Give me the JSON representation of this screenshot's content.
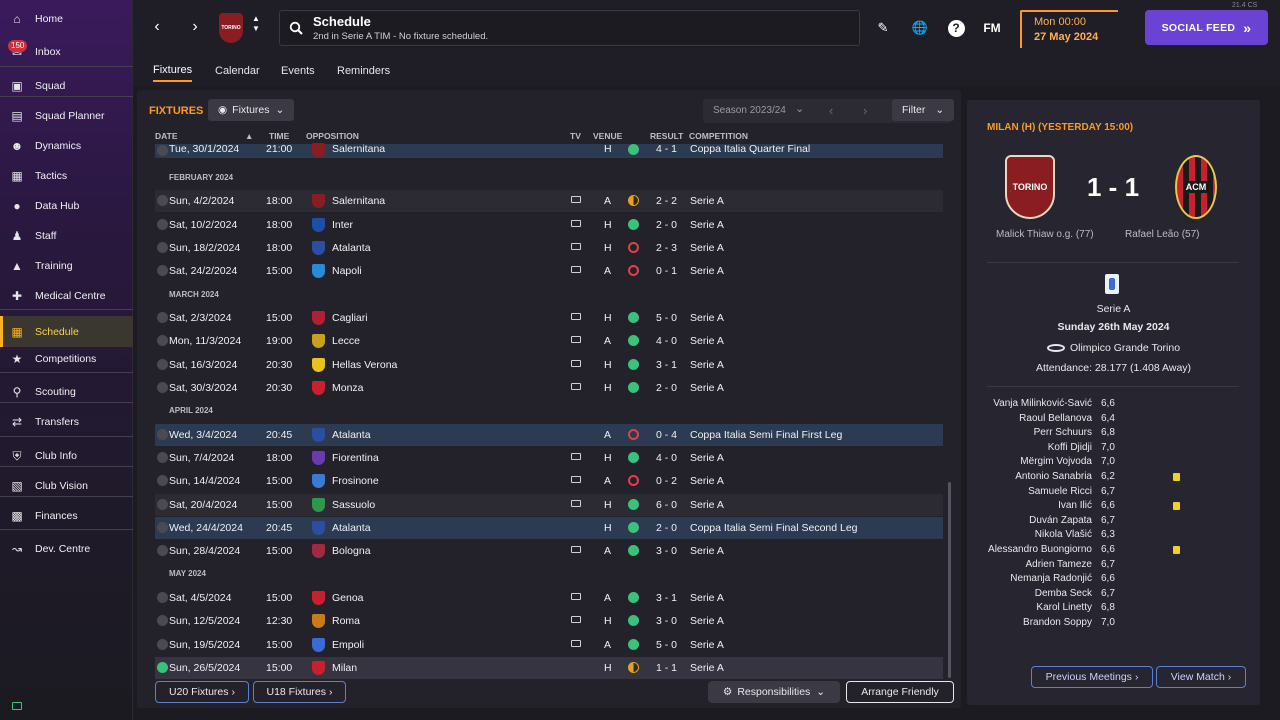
{
  "version_label": "21.4 CS",
  "sidebar": {
    "inbox_badge": "150",
    "items": [
      {
        "label": "Home",
        "icon": "home-icon"
      },
      {
        "label": "Inbox",
        "icon": "mail-icon"
      },
      {
        "label": "Squad",
        "icon": "shirt-icon"
      },
      {
        "label": "Squad Planner",
        "icon": "clipboard-icon"
      },
      {
        "label": "Dynamics",
        "icon": "people-icon"
      },
      {
        "label": "Tactics",
        "icon": "tactics-board-icon"
      },
      {
        "label": "Data Hub",
        "icon": "data-hub-icon"
      },
      {
        "label": "Staff",
        "icon": "staff-icon"
      },
      {
        "label": "Training",
        "icon": "cone-icon"
      },
      {
        "label": "Medical Centre",
        "icon": "medical-icon"
      },
      {
        "label": "Schedule",
        "icon": "calendar-icon"
      },
      {
        "label": "Competitions",
        "icon": "trophy-icon"
      },
      {
        "label": "Scouting",
        "icon": "magnifier-icon"
      },
      {
        "label": "Transfers",
        "icon": "transfer-arrows-icon"
      },
      {
        "label": "Club Info",
        "icon": "shield-icon"
      },
      {
        "label": "Club Vision",
        "icon": "briefcase-icon"
      },
      {
        "label": "Finances",
        "icon": "money-icon"
      },
      {
        "label": "Dev. Centre",
        "icon": "growth-icon"
      }
    ]
  },
  "header": {
    "title": "Schedule",
    "subtitle": "2nd in Serie A TIM - No fixture scheduled.",
    "club_crest_text": "TORINO",
    "fm_label": "FM",
    "date_line1": "Mon 00:00",
    "date_line2": "27 May 2024",
    "social_feed": "SOCIAL FEED"
  },
  "tabs": [
    "Fixtures",
    "Calendar",
    "Events",
    "Reminders"
  ],
  "fixtures": {
    "title": "FIXTURES",
    "view_button": "Fixtures",
    "season": "Season 2023/24",
    "filter": "Filter",
    "columns": {
      "date": "DATE",
      "time": "TIME",
      "opposition": "OPPOSITION",
      "tv": "TV",
      "venue": "VENUE",
      "result": "RESULT",
      "competition": "COMPETITION"
    },
    "months": [
      "FEBRUARY 2024",
      "MARCH 2024",
      "APRIL 2024",
      "MAY 2024"
    ],
    "rows": [
      {
        "date": "Tue, 30/1/2024",
        "time": "21:00",
        "opp": "Salernitana",
        "tv": false,
        "venue": "H",
        "outcome": "win",
        "result": "4 - 1",
        "comp": "Coppa Italia Quarter Final",
        "color": "#8a1d22"
      },
      {
        "date": "Sun, 4/2/2024",
        "time": "18:00",
        "opp": "Salernitana",
        "tv": true,
        "venue": "A",
        "outcome": "draw",
        "result": "2 - 2",
        "comp": "Serie A",
        "color": "#8a1d22"
      },
      {
        "date": "Sat, 10/2/2024",
        "time": "18:00",
        "opp": "Inter",
        "tv": true,
        "venue": "H",
        "outcome": "win",
        "result": "2 - 0",
        "comp": "Serie A",
        "color": "#1e4fa8"
      },
      {
        "date": "Sun, 18/2/2024",
        "time": "18:00",
        "opp": "Atalanta",
        "tv": true,
        "venue": "H",
        "outcome": "loss",
        "result": "2 - 3",
        "comp": "Serie A",
        "color": "#2b4fa0"
      },
      {
        "date": "Sat, 24/2/2024",
        "time": "15:00",
        "opp": "Napoli",
        "tv": true,
        "venue": "A",
        "outcome": "loss",
        "result": "0 - 1",
        "comp": "Serie A",
        "color": "#2a8ad4"
      },
      {
        "date": "Sat, 2/3/2024",
        "time": "15:00",
        "opp": "Cagliari",
        "tv": true,
        "venue": "H",
        "outcome": "win",
        "result": "5 - 0",
        "comp": "Serie A",
        "color": "#b02034"
      },
      {
        "date": "Mon, 11/3/2024",
        "time": "19:00",
        "opp": "Lecce",
        "tv": true,
        "venue": "A",
        "outcome": "win",
        "result": "4 - 0",
        "comp": "Serie A",
        "color": "#c8a020"
      },
      {
        "date": "Sat, 16/3/2024",
        "time": "20:30",
        "opp": "Hellas Verona",
        "tv": true,
        "venue": "H",
        "outcome": "win",
        "result": "3 - 1",
        "comp": "Serie A",
        "color": "#e8c21e"
      },
      {
        "date": "Sat, 30/3/2024",
        "time": "20:30",
        "opp": "Monza",
        "tv": true,
        "venue": "H",
        "outcome": "win",
        "result": "2 - 0",
        "comp": "Serie A",
        "color": "#c8202e"
      },
      {
        "date": "Wed, 3/4/2024",
        "time": "20:45",
        "opp": "Atalanta",
        "tv": false,
        "venue": "A",
        "outcome": "loss",
        "result": "0 - 4",
        "comp": "Coppa Italia Semi Final First Leg",
        "color": "#2b4fa0"
      },
      {
        "date": "Sun, 7/4/2024",
        "time": "18:00",
        "opp": "Fiorentina",
        "tv": true,
        "venue": "H",
        "outcome": "win",
        "result": "4 - 0",
        "comp": "Serie A",
        "color": "#6a3ab0"
      },
      {
        "date": "Sun, 14/4/2024",
        "time": "15:00",
        "opp": "Frosinone",
        "tv": true,
        "venue": "A",
        "outcome": "loss",
        "result": "0 - 2",
        "comp": "Serie A",
        "color": "#3a7ad4"
      },
      {
        "date": "Sat, 20/4/2024",
        "time": "15:00",
        "opp": "Sassuolo",
        "tv": true,
        "venue": "H",
        "outcome": "win",
        "result": "6 - 0",
        "comp": "Serie A",
        "color": "#2a9a4a"
      },
      {
        "date": "Wed, 24/4/2024",
        "time": "20:45",
        "opp": "Atalanta",
        "tv": false,
        "venue": "H",
        "outcome": "win",
        "result": "2 - 0",
        "comp": "Coppa Italia Semi Final Second Leg",
        "color": "#2b4fa0"
      },
      {
        "date": "Sun, 28/4/2024",
        "time": "15:00",
        "opp": "Bologna",
        "tv": true,
        "venue": "A",
        "outcome": "win",
        "result": "3 - 0",
        "comp": "Serie A",
        "color": "#a02a40"
      },
      {
        "date": "Sat, 4/5/2024",
        "time": "15:00",
        "opp": "Genoa",
        "tv": true,
        "venue": "A",
        "outcome": "win",
        "result": "3 - 1",
        "comp": "Serie A",
        "color": "#c8202e"
      },
      {
        "date": "Sun, 12/5/2024",
        "time": "12:30",
        "opp": "Roma",
        "tv": true,
        "venue": "H",
        "outcome": "win",
        "result": "3 - 0",
        "comp": "Serie A",
        "color": "#c87a1e"
      },
      {
        "date": "Sun, 19/5/2024",
        "time": "15:00",
        "opp": "Empoli",
        "tv": true,
        "venue": "A",
        "outcome": "win",
        "result": "5 - 0",
        "comp": "Serie A",
        "color": "#3a6ad4"
      },
      {
        "date": "Sun, 26/5/2024",
        "time": "15:00",
        "opp": "Milan",
        "tv": false,
        "venue": "H",
        "outcome": "draw",
        "result": "1 - 1",
        "comp": "Serie A",
        "color": "#c8202e"
      }
    ],
    "u20": "U20 Fixtures",
    "u18": "U18 Fixtures",
    "responsibilities": "Responsibilities",
    "arrange": "Arrange Friendly"
  },
  "match": {
    "title": "MILAN (H) (YESTERDAY 15:00)",
    "home_crest": "TORINO",
    "away_crest": "ACM",
    "score": "1 - 1",
    "home_scorer": "Malick Thiaw o.g. (77)",
    "away_scorer": "Rafael Leão (57)",
    "competition": "Serie A",
    "date": "Sunday 26th May 2024",
    "stadium": "Olimpico Grande Torino",
    "attendance": "Attendance: 28.177 (1.408 Away)",
    "players": [
      {
        "name": "Vanja Milinković-Savić",
        "rating": "6,6",
        "yellow": false
      },
      {
        "name": "Raoul Bellanova",
        "rating": "6,4",
        "yellow": false
      },
      {
        "name": "Perr Schuurs",
        "rating": "6,8",
        "yellow": false
      },
      {
        "name": "Koffi Djidji",
        "rating": "7,0",
        "yellow": false
      },
      {
        "name": "Mërgim Vojvoda",
        "rating": "7,0",
        "yellow": false
      },
      {
        "name": "Antonio Sanabria",
        "rating": "6,2",
        "yellow": true
      },
      {
        "name": "Samuele Ricci",
        "rating": "6,7",
        "yellow": false
      },
      {
        "name": "Ivan Ilić",
        "rating": "6,6",
        "yellow": true
      },
      {
        "name": "Duván Zapata",
        "rating": "6,7",
        "yellow": false
      },
      {
        "name": "Nikola Vlašić",
        "rating": "6,3",
        "yellow": false
      },
      {
        "name": "Alessandro Buongiorno",
        "rating": "6,6",
        "yellow": true
      },
      {
        "name": "Adrien Tameze",
        "rating": "6,7",
        "yellow": false
      },
      {
        "name": "Nemanja Radonjić",
        "rating": "6,6",
        "yellow": false
      },
      {
        "name": "Demba Seck",
        "rating": "6,7",
        "yellow": false
      },
      {
        "name": "Karol Linetty",
        "rating": "6,8",
        "yellow": false
      },
      {
        "name": "Brandon Soppy",
        "rating": "7,0",
        "yellow": false
      }
    ],
    "prev_meetings": "Previous Meetings",
    "view_match": "View Match"
  },
  "colors": {
    "accent": "#ff9a1e",
    "social": "#6b43d4",
    "win": "#39c27a",
    "loss": "#e0404a",
    "draw": "#e6a21e"
  }
}
